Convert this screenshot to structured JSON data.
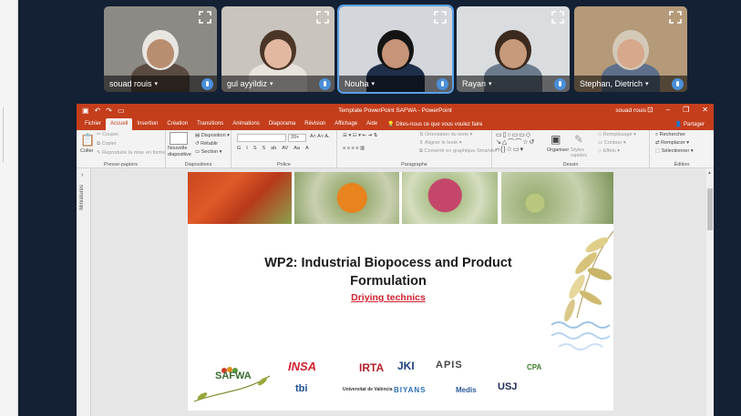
{
  "participants": [
    {
      "name": "souad rouis",
      "skin": "#b98e70",
      "hair": "#e9e6e2",
      "body": "#5a4a40",
      "bg": "#8d8a86"
    },
    {
      "name": "gul ayyildiz",
      "skin": "#e2b9a0",
      "hair": "#4a3526",
      "body": "#e8e3dc",
      "bg": "#c9c4bd"
    },
    {
      "name": "Nouha",
      "skin": "#c69478",
      "hair": "#141414",
      "body": "#1f2f4a",
      "bg": "#d3d6db"
    },
    {
      "name": "Rayan",
      "skin": "#c89a7c",
      "hair": "#3c2a1f",
      "body": "#6b7a8c",
      "bg": "#d9dde0"
    },
    {
      "name": "Stephan, Dietrich",
      "skin": "#d7a88c",
      "hair": "#d4c9b8",
      "body": "#5d6f8a",
      "bg": "#b49a78"
    }
  ],
  "ppt": {
    "title": "Template PowerPoint SAFWA  -  PowerPoint",
    "user": "souad rouis",
    "tabs": [
      "Fichier",
      "Accueil",
      "Insertion",
      "Création",
      "Transitions",
      "Animations",
      "Diaporama",
      "Révision",
      "Affichage",
      "Aide"
    ],
    "tell_me": "Dites-nous ce que vous voulez faire",
    "share": "Partager",
    "ribbon": {
      "clipboard": {
        "paste": "Coller",
        "cut": "Couper",
        "copy": "Copier",
        "format": "Reproduire la mise en forme",
        "label": "Presse-papiers"
      },
      "slides": {
        "new": "Nouvelle diapositive",
        "layout": "Disposition",
        "reset": "Rétablir",
        "section": "Section",
        "label": "Diapositives"
      },
      "font": {
        "size": "20+",
        "label": "Police",
        "styles": [
          "G",
          "I",
          "S",
          "S",
          "ab",
          "AV",
          "Aa",
          "A"
        ]
      },
      "paragraph": {
        "direction": "Orientation du texte",
        "align": "Aligner le texte",
        "smartart": "Convertir en graphique SmartArt",
        "label": "Paragraphe"
      },
      "drawing": {
        "arrange": "Organiser",
        "quick": "Styles rapides",
        "fill": "Remplissage",
        "outline": "Contour",
        "effects": "Effets",
        "label": "Dessin"
      },
      "editing": {
        "find": "Rechercher",
        "replace": "Remplacer",
        "select": "Sélectionner",
        "label": "Édition"
      }
    },
    "thumbnails_label": "Miniatures"
  },
  "slide": {
    "title_line1": "WP2: Industrial Biopocess and Product",
    "title_line2": "Formulation",
    "subtitle": "Driying technics",
    "logos": [
      "SAFWA",
      "INSA",
      "IRTA",
      "JKI",
      "APIS",
      "CPA",
      "tbi",
      "Universitat de València",
      "BIYANS",
      "Medis",
      "USJ"
    ]
  }
}
